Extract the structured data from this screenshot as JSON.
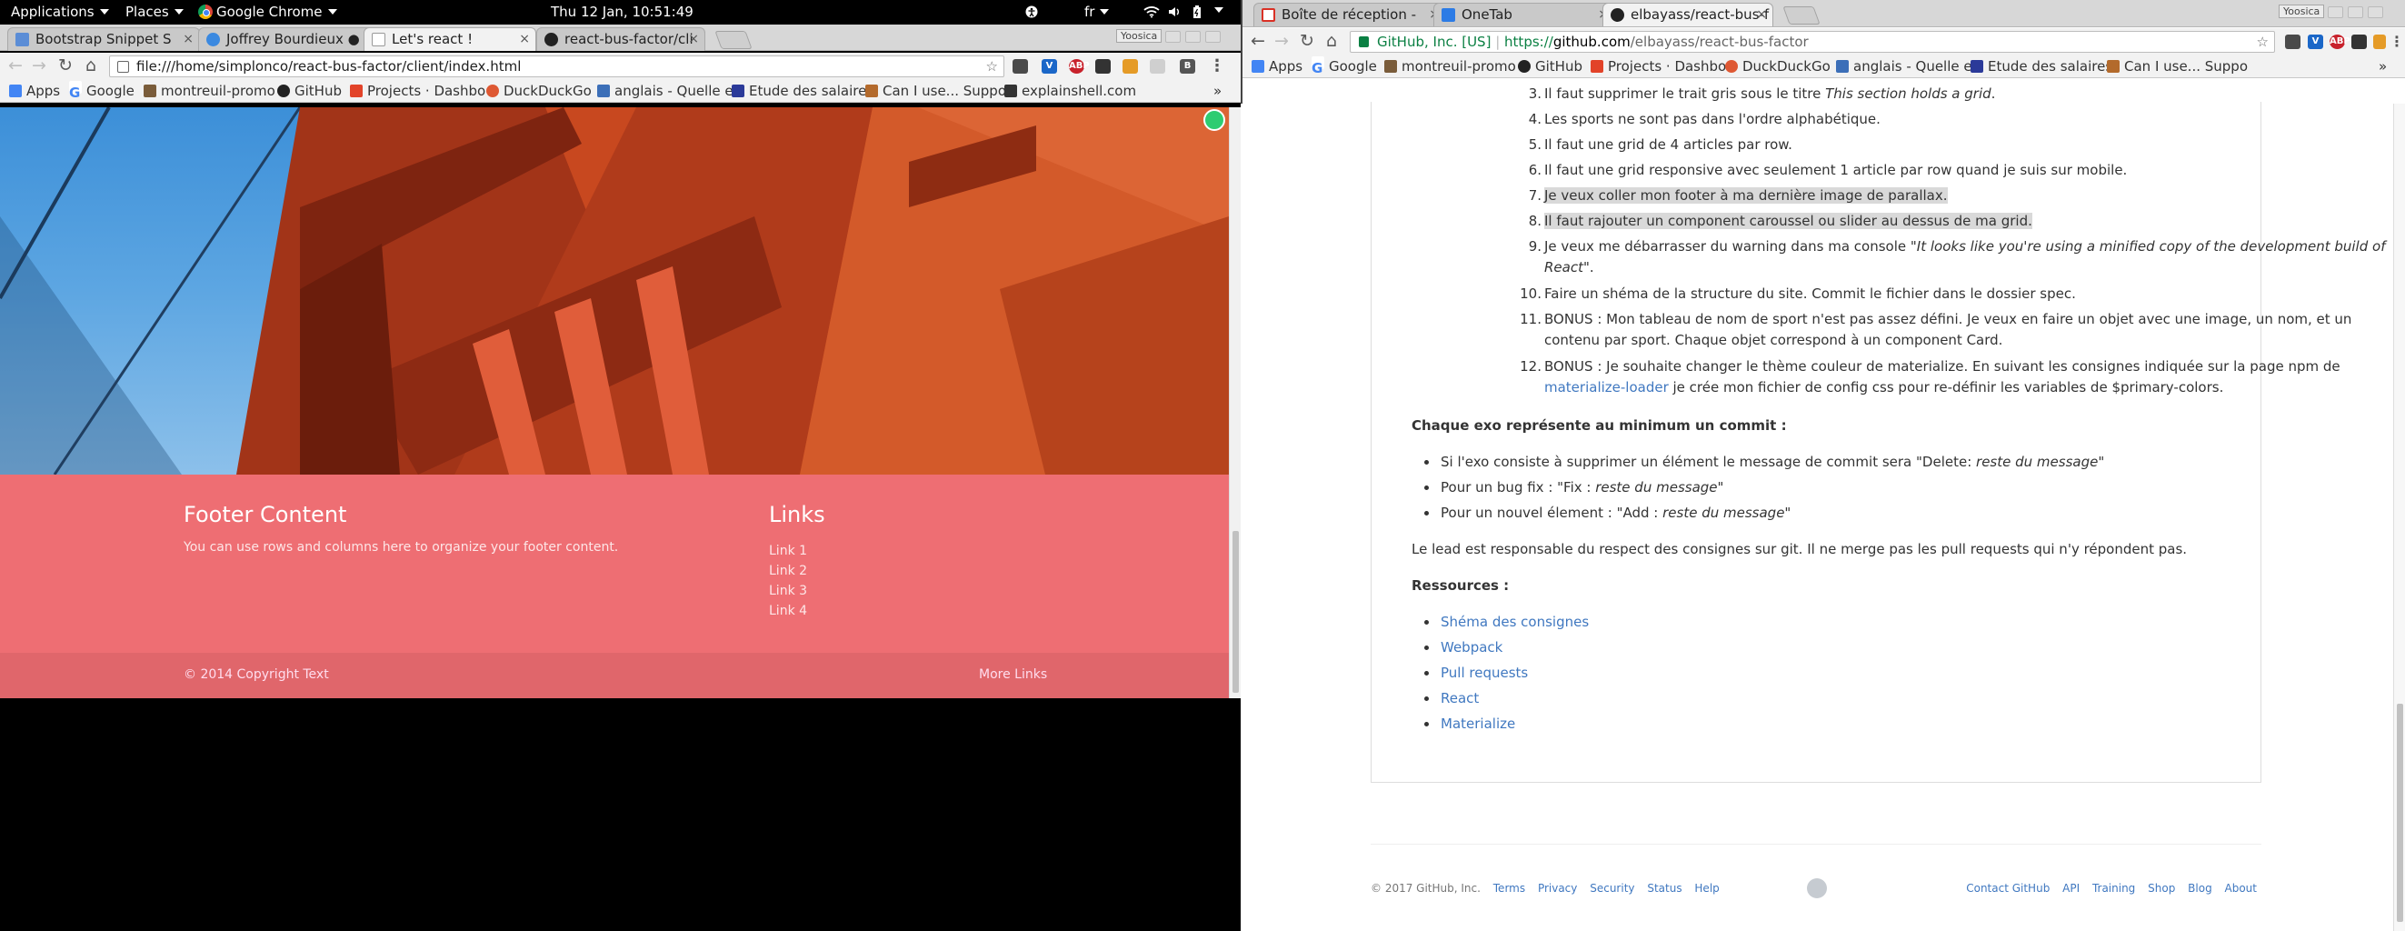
{
  "top_panel": {
    "applications": "Applications",
    "places": "Places",
    "app": "Google Chrome",
    "clock": "Thu 12 Jan, 10:51:49",
    "keyboard": "fr"
  },
  "left_window": {
    "tabs": [
      {
        "label": "Bootstrap Snippet S",
        "favicon_color": "#5b8dd6",
        "active": false
      },
      {
        "label": "Joffrey Bourdieux ●",
        "favicon_color": "#3b89e0",
        "active": false
      },
      {
        "label": "Let's react !",
        "favicon_color": "#ffffff",
        "active": true
      },
      {
        "label": "react-bus-factor/cli",
        "favicon_color": "#222222",
        "active": false
      }
    ],
    "user_badge": "Yoosica",
    "url": "file:///home/simplonco/react-bus-factor/client/index.html",
    "bookmarks": [
      "Apps",
      "Google",
      "montreuil-promo",
      "GitHub",
      "Projects · Dashbo",
      "DuckDuckGo",
      "anglais - Quelle e",
      "Etude des salaires",
      "Can I use... Suppo",
      "explainshell.com"
    ],
    "bookmarks_more": "»",
    "page": {
      "footer_title": "Footer Content",
      "footer_text": "You can use rows and columns here to organize your footer content.",
      "links_title": "Links",
      "links": [
        "Link 1",
        "Link 2",
        "Link 3",
        "Link 4"
      ],
      "copyright": "© 2014 Copyright Text",
      "more_links": "More Links"
    }
  },
  "right_window": {
    "tabs": [
      {
        "label": "Boîte de réception -",
        "favicon_color": "#d93025",
        "active": false
      },
      {
        "label": "OneTab",
        "favicon_color": "#2c7be5",
        "active": false
      },
      {
        "label": "elbayass/react-bus-f",
        "favicon_color": "#222222",
        "active": true
      }
    ],
    "user_badge": "Yoosica",
    "url_org": "GitHub, Inc. [US]",
    "url_scheme": "https://",
    "url_host": "github.com",
    "url_path": "/elbayass/react-bus-factor",
    "bookmarks": [
      "Apps",
      "Google",
      "montreuil-promo",
      "GitHub",
      "Projects · Dashbo",
      "DuckDuckGo",
      "anglais - Quelle e",
      "Etude des salaires",
      "Can I use... Suppo"
    ],
    "bookmarks_more": "»",
    "readme": {
      "items": [
        {
          "num": "3.",
          "text": "Il faut supprimer le trait gris sous le titre ",
          "em": "This section holds a grid",
          "after": "."
        },
        {
          "num": "4.",
          "text": "Les sports ne sont pas dans l'ordre alphabétique."
        },
        {
          "num": "5.",
          "text": "Il faut une grid de 4 articles par row."
        },
        {
          "num": "6.",
          "text": "Il faut une grid responsive avec seulement 1 article par row quand je suis sur mobile."
        },
        {
          "num": "7.",
          "text": "Je veux coller mon footer à ma dernière image de parallax."
        },
        {
          "num": "8.",
          "text": "Il faut rajouter un component caroussel ou slider au dessus de ma grid."
        },
        {
          "num": "9.",
          "text": "Je veux me débarrasser du warning dans ma console ",
          "em": "\"It looks like you're using a minified copy of the development build of",
          "line2_em": "React\"",
          "line2_after": "."
        },
        {
          "num": "10.",
          "text": "Faire un shéma de la structure du site. Commit le fichier dans le dossier spec."
        },
        {
          "num": "11.",
          "text": "BONUS : Mon tableau de nom de sport n'est pas assez défini. Je veux en faire un objet avec une image, un nom, et un",
          "line2": "contenu par sport. Chaque objet correspond à un component Card."
        },
        {
          "num": "12.",
          "text": "BONUS : Je souhaite changer le thème couleur de materialize. En suivant les consignes indiquée sur la page npm de",
          "line2_link": "materialize-loader",
          "line2": " je crée mon fichier de config css pour re-définir les variables de $primary-colors."
        }
      ],
      "commit_heading": "Chaque exo représente au minimum un commit :",
      "commit_rules": [
        {
          "text": "Si l'exo consiste à supprimer un élément le message de commit sera \"Delete: ",
          "em": "reste du message",
          "after": "\""
        },
        {
          "text": "Pour un bug fix : \"Fix : ",
          "em": "reste du message",
          "after": "\""
        },
        {
          "text": "Pour un nouvel élement : \"Add : ",
          "em": "reste du message",
          "after": "\""
        }
      ],
      "lead_text": "Le lead est responsable du respect des consignes sur git. Il ne merge pas les pull requests qui n'y répondent pas.",
      "resources_heading": "Ressources :",
      "resources": [
        "Shéma des consignes",
        "Webpack",
        "Pull requests",
        "React",
        "Materialize"
      ]
    },
    "footer": {
      "copyright": "© 2017 GitHub, Inc.",
      "left_links": [
        "Terms",
        "Privacy",
        "Security",
        "Status",
        "Help"
      ],
      "right_links": [
        "Contact GitHub",
        "API",
        "Training",
        "Shop",
        "Blog",
        "About"
      ]
    }
  },
  "colors": {
    "footer_bg": "#ee6e73",
    "footer_copy_bg": "#e0666b",
    "link": "#4078c0",
    "highlight": "#d9d9d9"
  }
}
